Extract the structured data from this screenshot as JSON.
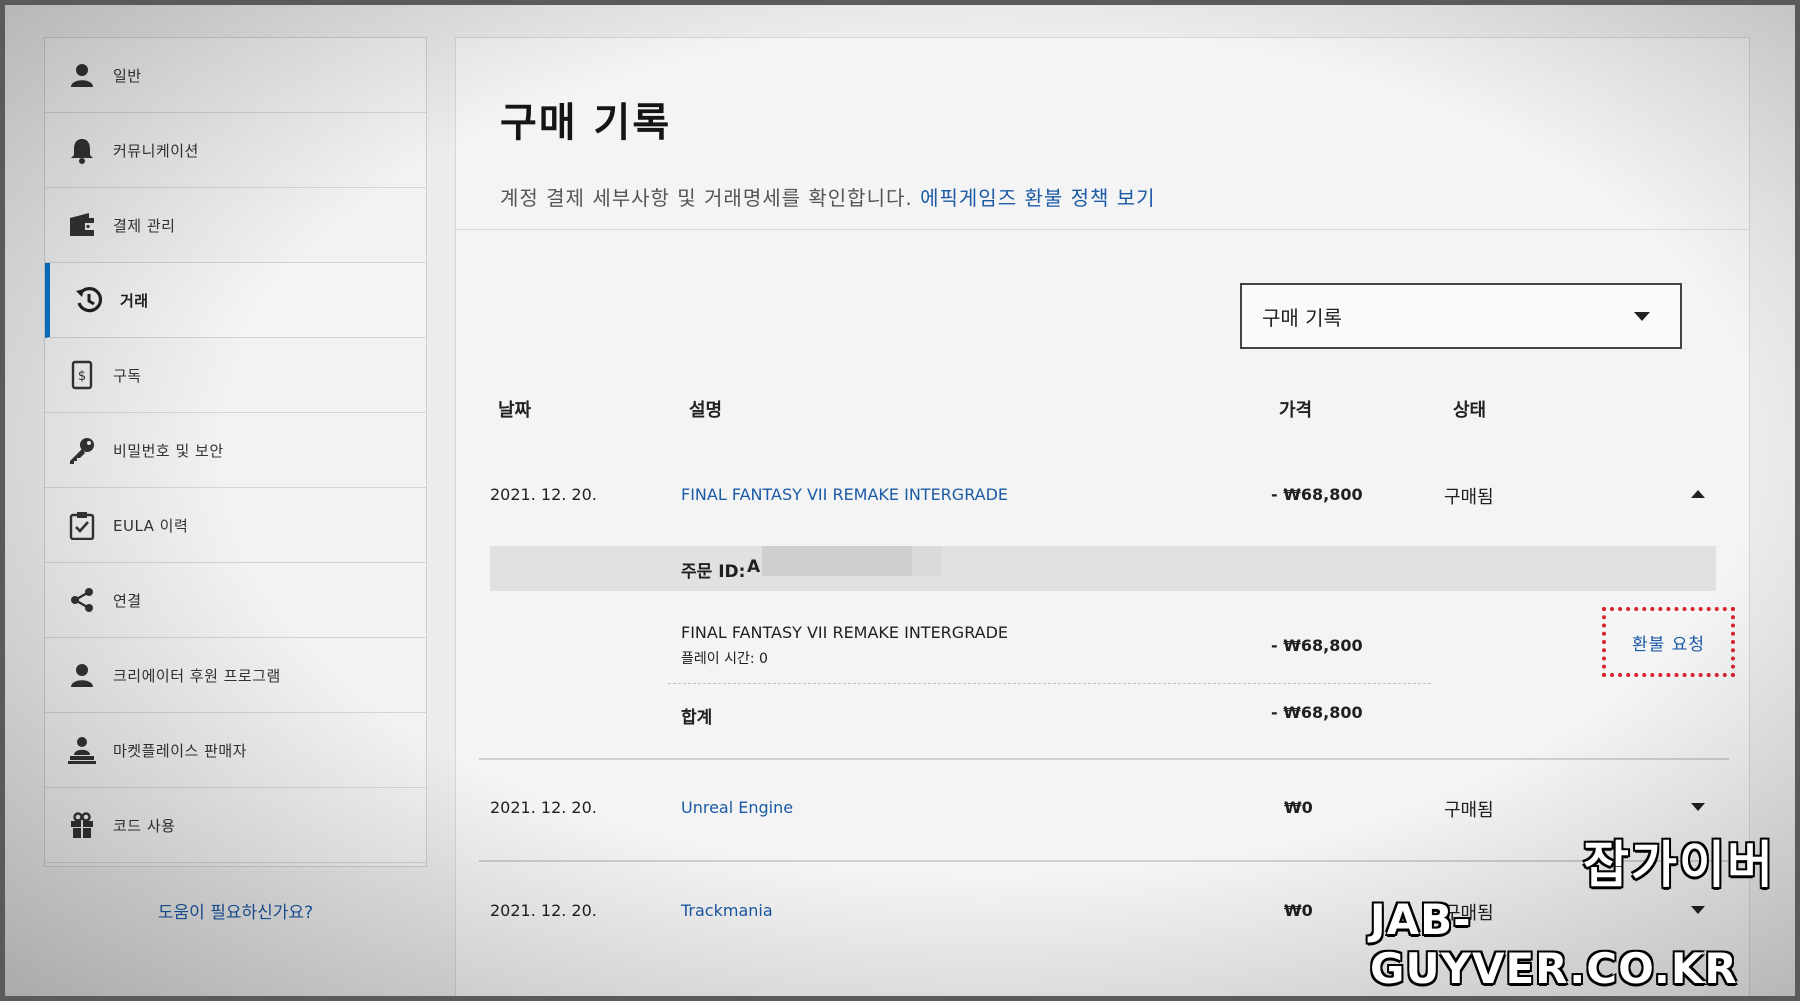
{
  "sidebar": {
    "items": [
      {
        "label": "일반",
        "icon": "user-icon"
      },
      {
        "label": "커뮤니케이션",
        "icon": "bell-icon"
      },
      {
        "label": "결제 관리",
        "icon": "wallet-icon"
      },
      {
        "label": "거래",
        "icon": "history-icon",
        "active": true
      },
      {
        "label": "구독",
        "icon": "receipt-icon"
      },
      {
        "label": "비밀번호 및 보안",
        "icon": "key-icon"
      },
      {
        "label": "EULA 이력",
        "icon": "clipboard-check-icon"
      },
      {
        "label": "연결",
        "icon": "share-icon"
      },
      {
        "label": "크리에이터 후원 프로그램",
        "icon": "user-icon"
      },
      {
        "label": "마켓플레이스 판매자",
        "icon": "seller-icon"
      },
      {
        "label": "코드 사용",
        "icon": "gift-icon"
      }
    ],
    "help": "도움이 필요하신가요?"
  },
  "header": {
    "title": "구매 기록",
    "subtitle": "계정 결제 세부사항 및 거래명세를 확인합니다.",
    "policy_link": "에픽게임즈 환불 정책 보기"
  },
  "filter": {
    "selected": "구매 기록"
  },
  "table": {
    "headers": {
      "date": "날짜",
      "description": "설명",
      "price": "가격",
      "status": "상태"
    },
    "rows": [
      {
        "date": "2021. 12. 20.",
        "description": "FINAL FANTASY VII REMAKE INTERGRADE",
        "price": "- ₩68,800",
        "status": "구매됨",
        "expanded": true
      },
      {
        "date": "2021. 12. 20.",
        "description": "Unreal Engine",
        "price": "₩0",
        "status": "구매됨",
        "expanded": false
      },
      {
        "date": "2021. 12. 20.",
        "description": "Trackmania",
        "price": "₩0",
        "status": "구매됨",
        "expanded": false
      }
    ],
    "detail": {
      "order_id_label": "주문 ID:",
      "order_id_value": "A",
      "item_name": "FINAL FANTASY VII REMAKE INTERGRADE",
      "playtime": "플레이 시간: 0",
      "item_price": "- ₩68,800",
      "refund_label": "환불 요청",
      "total_label": "합계",
      "total_price": "- ₩68,800"
    }
  },
  "watermark": {
    "korean": "잡가이버",
    "url": "JAB-GUYVER.CO.KR"
  },
  "colors": {
    "link": "#1b5aa6",
    "accent": "#0a74c9",
    "highlight": "#d8232a"
  }
}
